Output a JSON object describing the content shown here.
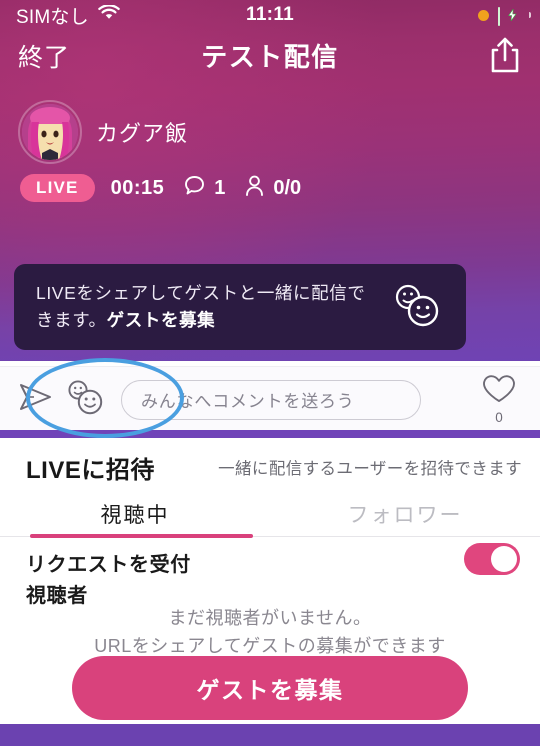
{
  "status_bar": {
    "carrier": "SIMなし",
    "wifi_icon": "wifi-icon",
    "time": "11:11",
    "recording_indicator": "orange-dot-icon",
    "battery_icon": "battery-charging-icon"
  },
  "nav": {
    "end_label": "終了",
    "title": "テスト配信",
    "share_icon": "share-icon"
  },
  "streamer": {
    "avatar_name": "avatar",
    "name": "カグア飯"
  },
  "meta": {
    "live_badge": "LIVE",
    "timer": "00:15",
    "comment_icon": "comment-bubble-icon",
    "comment_count": "1",
    "viewer_icon": "person-icon",
    "viewer_count": "0/0"
  },
  "share_banner": {
    "text_normal": "LIVEをシェアしてゲストと一緒に配信できます。",
    "text_bold": "ゲストを募集",
    "icon": "two-faces-icon"
  },
  "comment_bar": {
    "send_icon": "send-arrow-icon",
    "guest_faces_icon": "two-faces-icon",
    "input_placeholder": "みんなへコメントを送ろう",
    "input_value": "",
    "heart_icon": "heart-outline-icon",
    "heart_count": "0"
  },
  "invite_panel": {
    "title": "LIVEに招待",
    "subtitle": "一緒に配信するユーザーを招待できます",
    "tabs": [
      {
        "label": "視聴中",
        "active": true
      },
      {
        "label": "フォロワー",
        "active": false
      }
    ],
    "request_toggle_label": "リクエストを受付",
    "request_toggle_state": "on",
    "viewers_label": "視聴者",
    "empty_line1": "まだ視聴者がいません。",
    "empty_line2": "URLをシェアしてゲストの募集ができます",
    "cta_label": "ゲストを募集"
  },
  "annotation": {
    "shape": "blue-ellipse-highlight",
    "color": "#4a9fe0"
  },
  "colors": {
    "accent_pink": "#d9427c",
    "live_badge_pink": "#ef5d92",
    "toggle_pink": "#e0467e",
    "banner_dark": "#2b1b41",
    "purple_band": "#7044b8",
    "bottom_bar_purple": "#6b42b0",
    "annotation_blue": "#4a9fe0"
  }
}
